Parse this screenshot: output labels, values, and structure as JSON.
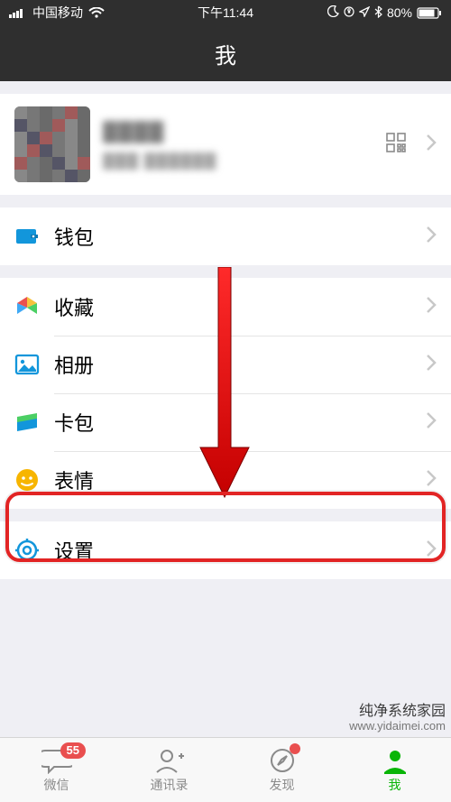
{
  "status": {
    "carrier": "中国移动",
    "time": "下午11:44",
    "battery_text": "80%"
  },
  "header": {
    "title": "我"
  },
  "profile": {
    "name_obscured": "▓▓▓▓",
    "id_obscured": "▓▓▓ ▓▓▓▓▓▓"
  },
  "rows": {
    "wallet": "钱包",
    "favorites": "收藏",
    "photos": "相册",
    "cards": "卡包",
    "stickers": "表情",
    "settings": "设置"
  },
  "tabs": {
    "chats": "微信",
    "contacts": "通讯录",
    "discover": "发现",
    "me": "我",
    "chats_badge": "55"
  },
  "watermark": {
    "line1": "纯净系统家园",
    "line2": "www.yidaimei.com"
  },
  "colors": {
    "highlight": "#e22424",
    "active_tab": "#09b507"
  }
}
